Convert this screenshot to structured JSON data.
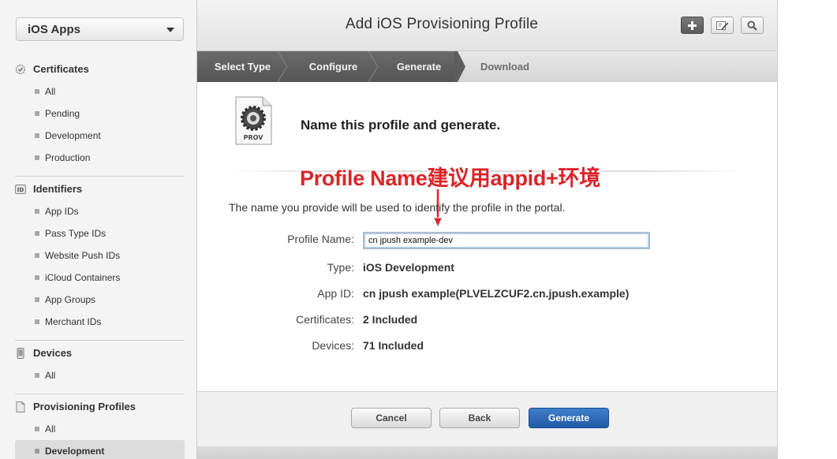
{
  "sidebar": {
    "app_select": "iOS Apps",
    "sections": [
      {
        "title": "Certificates",
        "icon": "certificate-icon",
        "items": [
          "All",
          "Pending",
          "Development",
          "Production"
        ]
      },
      {
        "title": "Identifiers",
        "icon": "id-icon",
        "icon_text": "ID",
        "items": [
          "App IDs",
          "Pass Type IDs",
          "Website Push IDs",
          "iCloud Containers",
          "App Groups",
          "Merchant IDs"
        ]
      },
      {
        "title": "Devices",
        "icon": "device-icon",
        "items": [
          "All"
        ]
      },
      {
        "title": "Provisioning Profiles",
        "icon": "document-icon",
        "items": [
          "All",
          "Development"
        ],
        "active_item": "Development"
      }
    ]
  },
  "header": {
    "title": "Add iOS Provisioning Profile",
    "tools": [
      "add-icon",
      "edit-icon",
      "search-icon"
    ]
  },
  "steps": [
    {
      "label": "Select Type",
      "state": "done"
    },
    {
      "label": "Configure",
      "state": "done"
    },
    {
      "label": "Generate",
      "state": "current"
    },
    {
      "label": "Download",
      "state": "pending"
    }
  ],
  "content": {
    "file_icon_label": "PROV",
    "heading": "Name this profile and generate.",
    "annotation": "Profile Name建议用appid+环境",
    "description": "The name you provide will be used to identify the profile in the portal.",
    "profile_name_label": "Profile Name:",
    "profile_name_value": "cn jpush example-dev",
    "type_label": "Type:",
    "type_value": "iOS Development",
    "appid_label": "App ID:",
    "appid_value": "cn jpush example(PLVELZCUF2.cn.jpush.example)",
    "certs_label": "Certificates:",
    "certs_value": "2 Included",
    "devices_label": "Devices:",
    "devices_value": "71 Included"
  },
  "footer": {
    "cancel": "Cancel",
    "back": "Back",
    "generate": "Generate"
  },
  "colors": {
    "accent_blue": "#1f5aa5",
    "annotation_red": "#d9252a",
    "steps_dark": "#5f5f5f"
  }
}
